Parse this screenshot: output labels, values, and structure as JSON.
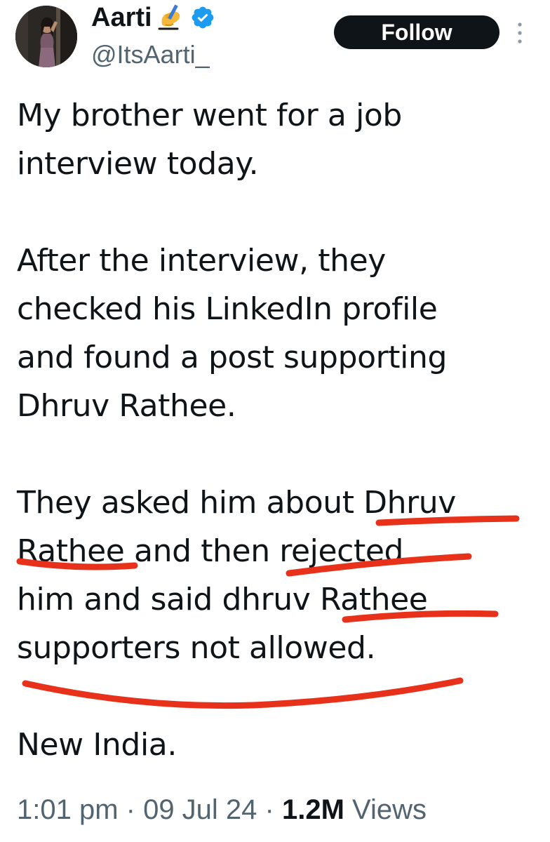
{
  "author": {
    "display_name": "Aarti",
    "name_emoji": "writing-hand",
    "verified": true,
    "verified_color": "#1d9bf0",
    "handle": "@ItsAarti_"
  },
  "actions": {
    "follow_label": "Follow",
    "more_icon": "more-vertical-icon"
  },
  "tweet": {
    "paragraphs": [
      [
        "My brother went for a job",
        "interview today."
      ],
      [
        "After the interview, they",
        "checked his LinkedIn profile",
        "and found a post supporting",
        "Dhruv Rathee."
      ],
      [
        "They asked him about Dhruv",
        "Rathee and then rejected",
        "him and said dhruv Rathee",
        "supporters not allowed."
      ],
      [
        "New India."
      ]
    ],
    "annotation_color": "#e8311a"
  },
  "meta": {
    "time": "1:01 pm",
    "separator": " · ",
    "date": "09 Jul 24",
    "views_count": "1.2M",
    "views_label": " Views"
  },
  "colors": {
    "text": "#0f1419",
    "secondary": "#536471",
    "button_bg": "#0f1419",
    "button_text": "#ffffff"
  }
}
